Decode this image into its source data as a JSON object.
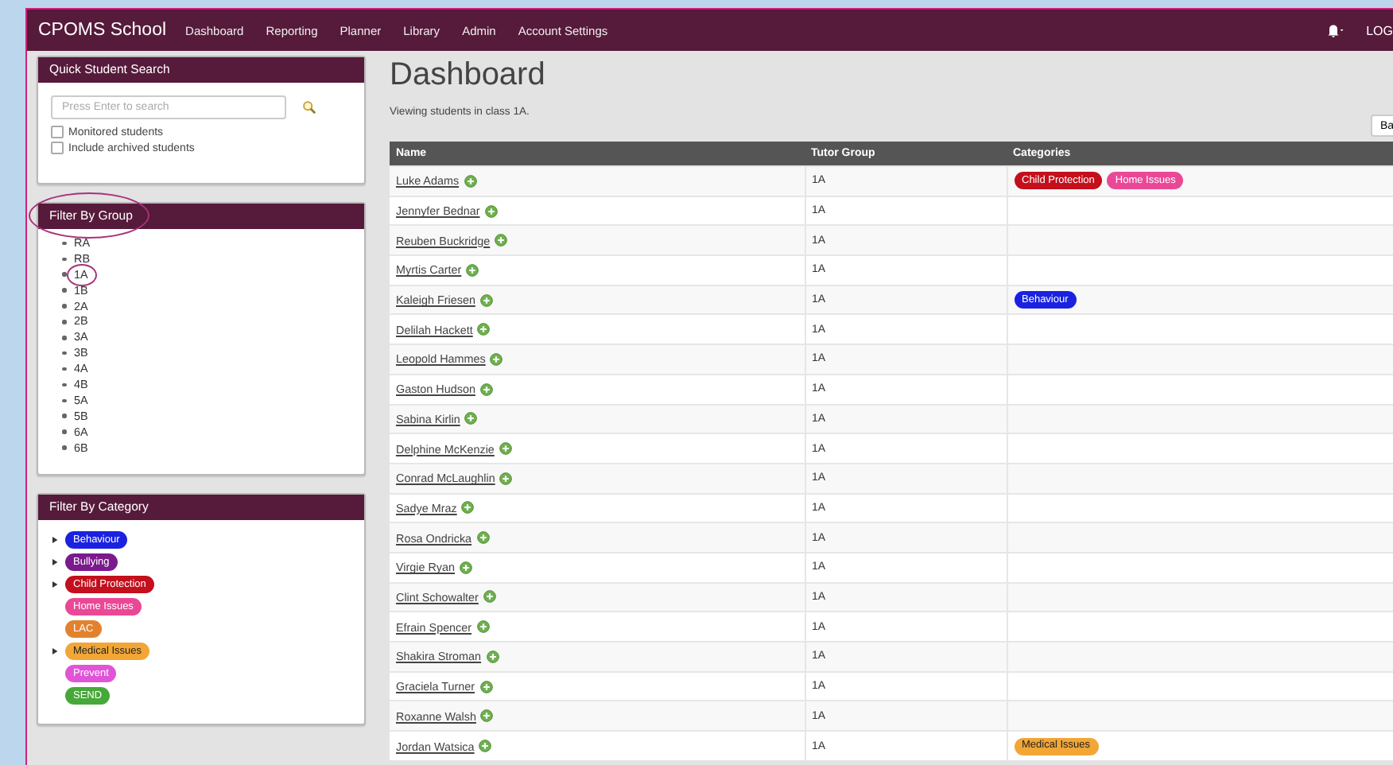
{
  "navbar": {
    "brand": "CPOMS School",
    "links": [
      "Dashboard",
      "Reporting",
      "Planner",
      "Library",
      "Admin",
      "Account Settings"
    ],
    "logout": "LOG"
  },
  "quick_search": {
    "title": "Quick Student Search",
    "placeholder": "Press Enter to search",
    "options": [
      {
        "label": "Monitored students",
        "checked": false
      },
      {
        "label": "Include archived students",
        "checked": false
      }
    ]
  },
  "group_filter": {
    "title": "Filter By Group",
    "circled": true,
    "groups": [
      {
        "label": "RA",
        "circled": false
      },
      {
        "label": "RB",
        "circled": false
      },
      {
        "label": "1A",
        "circled": true
      },
      {
        "label": "1B",
        "circled": false
      },
      {
        "label": "2A",
        "circled": false
      },
      {
        "label": "2B",
        "circled": false
      },
      {
        "label": "3A",
        "circled": false
      },
      {
        "label": "3B",
        "circled": false
      },
      {
        "label": "4A",
        "circled": false
      },
      {
        "label": "4B",
        "circled": false
      },
      {
        "label": "5A",
        "circled": false
      },
      {
        "label": "5B",
        "circled": false
      },
      {
        "label": "6A",
        "circled": false
      },
      {
        "label": "6B",
        "circled": false
      }
    ]
  },
  "category_filter": {
    "title": "Filter By Category",
    "categories": [
      {
        "label": "Behaviour",
        "color": "#1a22e0",
        "has_children": true
      },
      {
        "label": "Bullying",
        "color": "#7a1a8c",
        "has_children": true
      },
      {
        "label": "Child Protection",
        "color": "#c40f1c",
        "has_children": true
      },
      {
        "label": "Home Issues",
        "color": "#ea4896",
        "has_children": false
      },
      {
        "label": "LAC",
        "color": "#e2822e",
        "has_children": false
      },
      {
        "label": "Medical Issues",
        "color": "#f2a636",
        "has_children": true
      },
      {
        "label": "Prevent",
        "color": "#e055d8",
        "has_children": false
      },
      {
        "label": "SEND",
        "color": "#47a83a",
        "has_children": false
      }
    ]
  },
  "main": {
    "title": "Dashboard",
    "subtitle": "Viewing students in class 1A.",
    "button": "Ba",
    "table": {
      "columns": [
        "Name",
        "Tutor Group",
        "Categories"
      ],
      "rows": [
        {
          "name": "Luke Adams",
          "group": "1A",
          "categories": [
            {
              "label": "Child Protection",
              "color": "#c40f1c"
            },
            {
              "label": "Home Issues",
              "color": "#ea4896"
            }
          ]
        },
        {
          "name": "Jennyfer Bednar",
          "group": "1A"
        },
        {
          "name": "Reuben Buckridge",
          "group": "1A"
        },
        {
          "name": "Myrtis Carter",
          "group": "1A"
        },
        {
          "name": "Kaleigh Friesen",
          "group": "1A",
          "categories": [
            {
              "label": "Behaviour",
              "color": "#1a22e0"
            }
          ]
        },
        {
          "name": "Delilah Hackett",
          "group": "1A"
        },
        {
          "name": "Leopold Hammes",
          "group": "1A"
        },
        {
          "name": "Gaston Hudson",
          "group": "1A"
        },
        {
          "name": "Sabina Kirlin",
          "group": "1A"
        },
        {
          "name": "Delphine McKenzie",
          "group": "1A"
        },
        {
          "name": "Conrad McLaughlin",
          "group": "1A"
        },
        {
          "name": "Sadye Mraz",
          "group": "1A"
        },
        {
          "name": "Rosa Ondricka",
          "group": "1A"
        },
        {
          "name": "Virgie Ryan",
          "group": "1A"
        },
        {
          "name": "Clint Schowalter",
          "group": "1A"
        },
        {
          "name": "Efrain Spencer",
          "group": "1A"
        },
        {
          "name": "Shakira Stroman",
          "group": "1A"
        },
        {
          "name": "Graciela Turner",
          "group": "1A"
        },
        {
          "name": "Roxanne Walsh",
          "group": "1A"
        },
        {
          "name": "Jordan Watsica",
          "group": "1A",
          "categories": [
            {
              "label": "Medical Issues",
              "color": "#f2a636"
            }
          ]
        }
      ]
    }
  }
}
